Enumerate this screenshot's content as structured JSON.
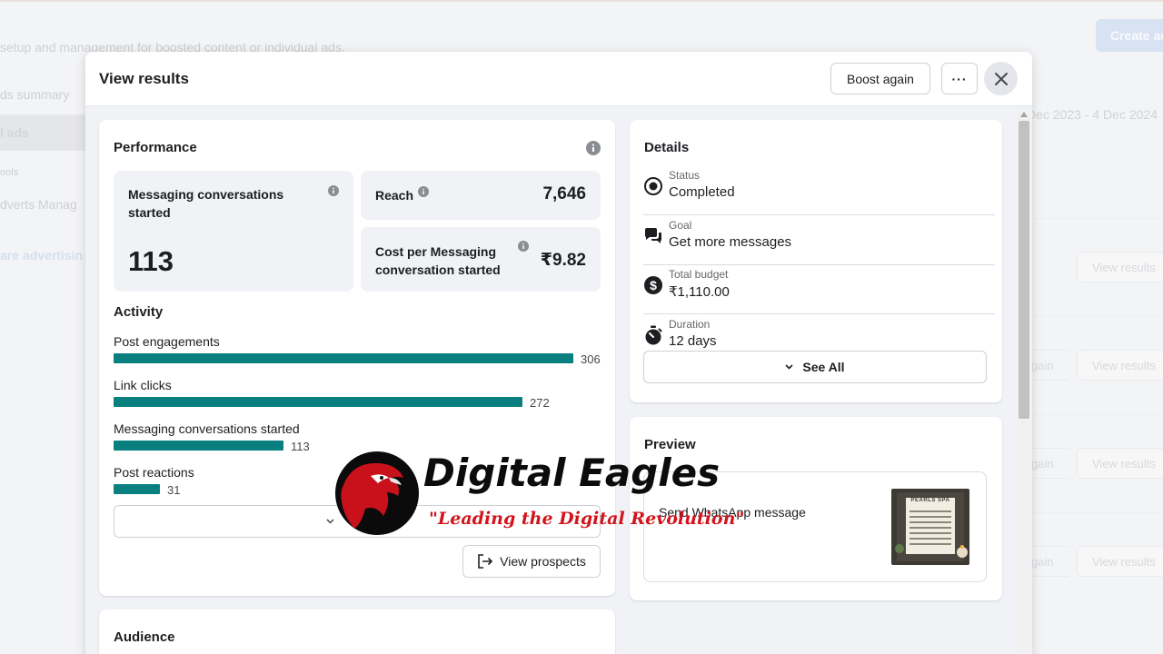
{
  "background": {
    "subtitle": " setup and management for boosted content or individual ads.",
    "create_button": "Create ad",
    "nav": [
      "ds summary",
      "l ads",
      "ools",
      "dverts Manag",
      "are advertisin"
    ],
    "date_range": "Dec 2023 - 4 Dec 2024",
    "rows": [
      {
        "left": "",
        "right": "View results"
      },
      {
        "left": "gain",
        "right": "View results"
      },
      {
        "left": "gain",
        "right": "View results"
      },
      {
        "left": "gain",
        "right": "View results"
      }
    ]
  },
  "modal": {
    "title": "View results",
    "boost_again": "Boost again",
    "more": "···"
  },
  "performance": {
    "heading": "Performance",
    "messaging": {
      "label": "Messaging conversations started",
      "value": "113"
    },
    "reach": {
      "label": "Reach",
      "value": "7,646"
    },
    "cost": {
      "label_line1": "Cost per Messaging",
      "label_line2": "conversation started",
      "value": "₹9.82"
    }
  },
  "activity": {
    "heading": "Activity",
    "max": 306,
    "items": [
      {
        "label": "Post engagements",
        "value": 306
      },
      {
        "label": "Link clicks",
        "value": 272
      },
      {
        "label": "Messaging conversations started",
        "value": 113
      },
      {
        "label": "Post reactions",
        "value": 31
      }
    ],
    "view_prospects": "View prospects"
  },
  "details": {
    "heading": "Details",
    "rows": [
      {
        "icon": "status-icon",
        "label": "Status",
        "value": "Completed"
      },
      {
        "icon": "chat-icon",
        "label": "Goal",
        "value": "Get more messages"
      },
      {
        "icon": "dollar-icon",
        "label": "Total budget",
        "value": "₹1,110.00"
      },
      {
        "icon": "stopwatch-icon",
        "label": "Duration",
        "value": "12 days"
      }
    ],
    "see_all": "See All"
  },
  "preview": {
    "heading": "Preview",
    "text": "Send WhatsApp message",
    "thumb_title": "PEARLS SPA"
  },
  "audience": {
    "heading": "Audience"
  },
  "watermark": {
    "title": "Digital Eagles",
    "tagline": "\"Leading the Digital Revolution\""
  },
  "colors": {
    "bar": "#0a7f7f",
    "brand_red": "#d1141b"
  }
}
